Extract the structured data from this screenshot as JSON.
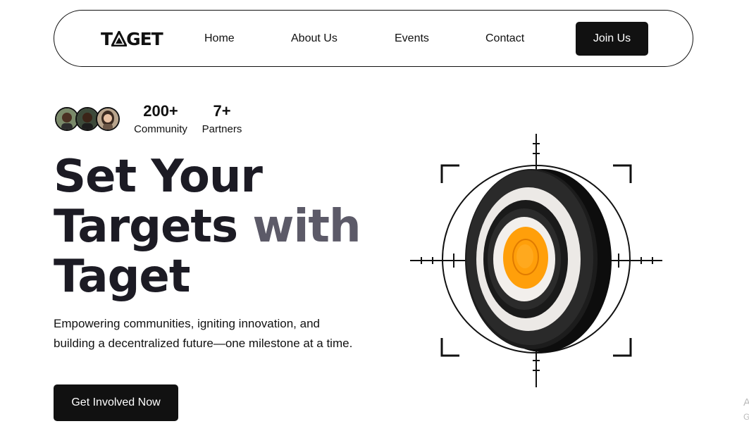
{
  "nav": {
    "logo_text": "TAGET",
    "links": [
      {
        "label": "Home"
      },
      {
        "label": "About Us"
      },
      {
        "label": "Events"
      },
      {
        "label": "Contact"
      }
    ],
    "join_label": "Join Us"
  },
  "stats": [
    {
      "value": "200+",
      "label": "Community"
    },
    {
      "value": "7+",
      "label": "Partners"
    }
  ],
  "hero": {
    "title_line1": "Set Your",
    "title_line2a": "Targets",
    "title_line2b": "with",
    "title_line3": "Taget",
    "subtitle": "Empowering communities, igniting innovation, and building a decentralized future—one milestone at a time.",
    "cta_label": "Get Involved Now"
  },
  "icons": {
    "avatars": [
      "avatar-1",
      "avatar-2",
      "avatar-3"
    ],
    "illustration": "target-bullseye-icon"
  },
  "colors": {
    "primary": "#111111",
    "accent_text": "#5c5a68",
    "bullseye": "#ff9f0a"
  },
  "edge_text": {
    "line1": "A",
    "line2": "G"
  }
}
